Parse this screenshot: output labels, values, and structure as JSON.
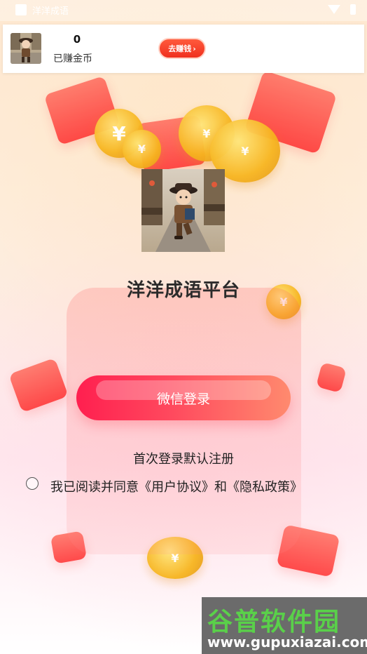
{
  "status_bar": {
    "app_title": "洋洋成语",
    "icons": [
      "app-icon",
      "wifi-icon",
      "battery-icon"
    ]
  },
  "earn_card": {
    "coin_count": "0",
    "coin_label": "已赚金币",
    "earn_button_label": "去赚钱",
    "earn_button_icon": "chevron-right-icon"
  },
  "main": {
    "app_title": "洋洋成语平台",
    "login_button_label": "微信登录",
    "register_hint": "首次登录默认注册",
    "agreement": {
      "prefix": "我已阅读并同意",
      "user_agreement": "《用户协议》",
      "connector": "和",
      "privacy_policy": "《隐私政策》",
      "checked": false
    }
  },
  "watermark": {
    "brand": "谷普软件园",
    "url": "www.gupuxiazai.com"
  },
  "colors": {
    "accent": "#ff2f4f",
    "earn_button": "#f0301e",
    "watermark_green": "#5ad04a"
  }
}
